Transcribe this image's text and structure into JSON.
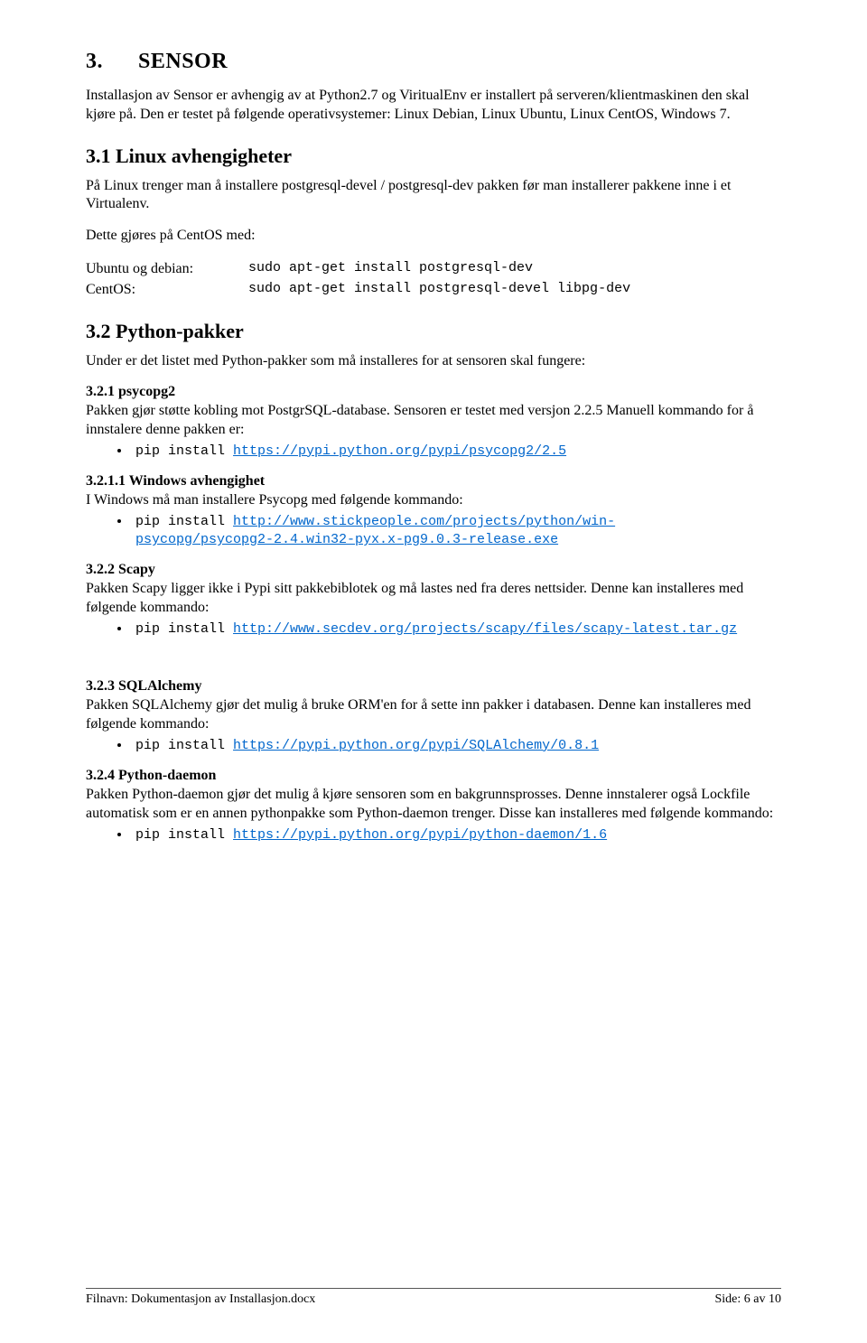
{
  "section": {
    "number": "3.",
    "title": "SENSOR"
  },
  "intro": "Installasjon av Sensor er avhengig av at Python2.7 og ViritualEnv er installert på serveren/klientmaskinen den skal kjøre på. Den er testet på følgende operativsystemer: Linux Debian, Linux Ubuntu, Linux CentOS, Windows 7.",
  "s31": {
    "heading": "3.1   Linux avhengigheter",
    "p1": "På Linux trenger man å installere postgresql-devel / postgresql-dev pakken før man installerer pakkene inne i et Virtualenv.",
    "p2": "Dette gjøres på CentOS med:",
    "rows": [
      {
        "label": "Ubuntu og debian:",
        "cmd": "sudo apt-get install postgresql-dev"
      },
      {
        "label": "CentOS:",
        "cmd": "sudo apt-get install postgresql-devel libpg-dev"
      }
    ]
  },
  "s32": {
    "heading": "3.2   Python-pakker",
    "p1": "Under er det listet med Python-pakker som må installeres for at sensoren skal fungere:"
  },
  "s321": {
    "heading": "3.2.1 psycopg2",
    "p1": "Pakken gjør støtte kobling mot PostgrSQL-database. Sensoren er testet med versjon 2.2.5 Manuell kommando for å innstalere denne pakken er:",
    "bullet_prefix": "pip install ",
    "bullet_link": "https://pypi.python.org/pypi/psycopg2/2.5"
  },
  "s3211": {
    "heading": "3.2.1.1       Windows avhengighet",
    "p1": "I Windows må man installere Psycopg med følgende kommando:",
    "bullet_prefix": "pip install ",
    "link_line1": "http://www.stickpeople.com/projects/python/win-",
    "link_line2": "psycopg/psycopg2-2.4.win32-pyx.x-pg9.0.3-release.exe"
  },
  "s322": {
    "heading": "3.2.2 Scapy",
    "p1": "Pakken Scapy ligger ikke i Pypi sitt pakkebiblotek og må lastes ned fra deres nettsider.  Denne kan installeres med følgende kommando:",
    "bullet_prefix": "pip install ",
    "bullet_link": "http://www.secdev.org/projects/scapy/files/scapy-latest.tar.gz"
  },
  "s323": {
    "heading": "3.2.3 SQLAlchemy",
    "p1": "Pakken SQLAlchemy gjør det mulig å bruke ORM'en for å sette inn pakker i databasen. Denne kan installeres med følgende kommando:",
    "bullet_prefix": "pip install ",
    "bullet_link": "https://pypi.python.org/pypi/SQLAlchemy/0.8.1"
  },
  "s324": {
    "heading": "3.2.4 Python-daemon",
    "p1": "Pakken Python-daemon gjør det mulig å kjøre sensoren som en bakgrunnsprosses. Denne innstalerer også Lockfile automatisk som er en annen pythonpakke som Python-daemon trenger.  Disse kan installeres med følgende kommando:",
    "bullet_prefix": "pip install ",
    "bullet_link": "https://pypi.python.org/pypi/python-daemon/1.6"
  },
  "footer": {
    "left": "Filnavn: Dokumentasjon av Installasjon.docx",
    "right": "Side: 6 av 10"
  }
}
